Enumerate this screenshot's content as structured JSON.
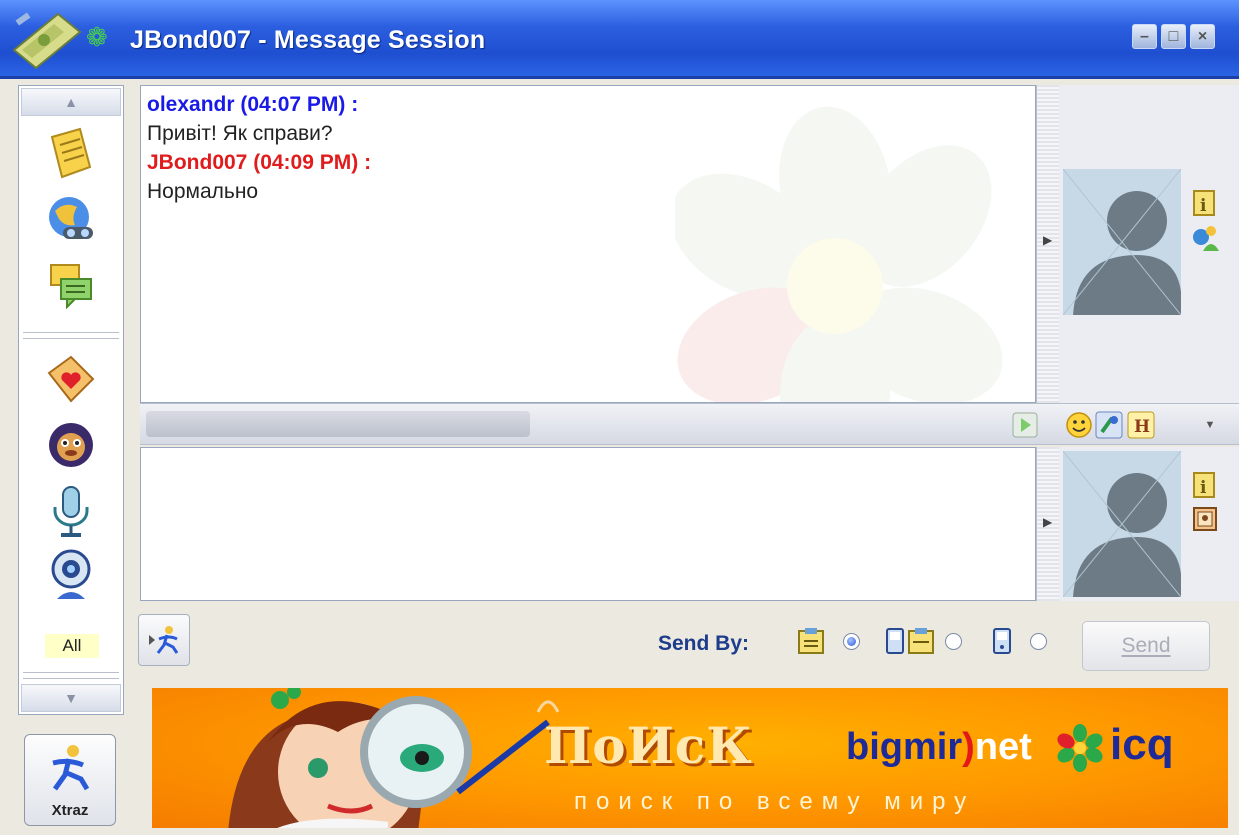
{
  "window": {
    "title": "JBond007 - Message Session",
    "title_icon": "icq-flower-icon"
  },
  "conversation": [
    {
      "header": "olexandr (04:07 PM) :",
      "text": "Привіт! Як справи?",
      "color": "#1a1ae6"
    },
    {
      "header": "JBond007 (04:09 PM) :",
      "text": "Нормально",
      "color": "#e01c1c"
    }
  ],
  "toolbar_left": {
    "items": [
      "notes-icon",
      "web-globe-icon",
      "chat-messages-icon",
      "greeting-card-icon",
      "monkey-game-icon",
      "microphone-icon",
      "webcam-icon"
    ],
    "all_label": "All",
    "xtraz_label": "Xtraz"
  },
  "send": {
    "send_by_label": "Send By:",
    "send_button": "Send",
    "options": [
      "message-icon",
      "sms-message-icon",
      "mobile-icon"
    ],
    "selected_index": 0
  },
  "banner": {
    "headline": "ПоИсК",
    "bigmir_a": "bigmir",
    "bigmir_paren": ")",
    "bigmir_b": "net",
    "icq": "icq",
    "tagline": "поиск по всему миру"
  }
}
